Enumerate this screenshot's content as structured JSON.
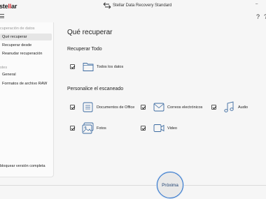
{
  "window": {
    "logo_text_a": "ste",
    "logo_text_b": "ll",
    "logo_text_c": "ar",
    "title": "Stellar Data Recovery Standard",
    "minimize": "–",
    "help": "?",
    "help2": "?"
  },
  "sidebar": {
    "section1": "cuperación de datos",
    "items1": [
      {
        "label": "Qué recuperar",
        "active": true
      },
      {
        "label": "Recuperar desde",
        "active": false
      },
      {
        "label": "Reanudar recuperación",
        "active": false
      }
    ],
    "section2": "stes",
    "items2": [
      {
        "label": "General"
      },
      {
        "label": "Formatos de archivo RAW"
      }
    ],
    "unlock": "bloquear versión completa"
  },
  "main": {
    "title": "Qué recuperar",
    "recover_all": {
      "heading": "Recuperar Todo",
      "option": "Todos los datos"
    },
    "custom": {
      "heading": "Personalice el escaneado",
      "options": [
        {
          "label": "Documentos de Office",
          "icon": "document-icon"
        },
        {
          "label": "Correos electrónicos",
          "icon": "email-icon"
        },
        {
          "label": "Audio",
          "icon": "music-note-icon"
        },
        {
          "label": "Fotos",
          "icon": "photos-icon"
        },
        {
          "label": "Video",
          "icon": "video-camera-icon"
        }
      ]
    }
  },
  "footer": {
    "next_label": "Próxima"
  },
  "colors": {
    "brand_red": "#d7282f",
    "accent_blue": "#2f73c9"
  }
}
